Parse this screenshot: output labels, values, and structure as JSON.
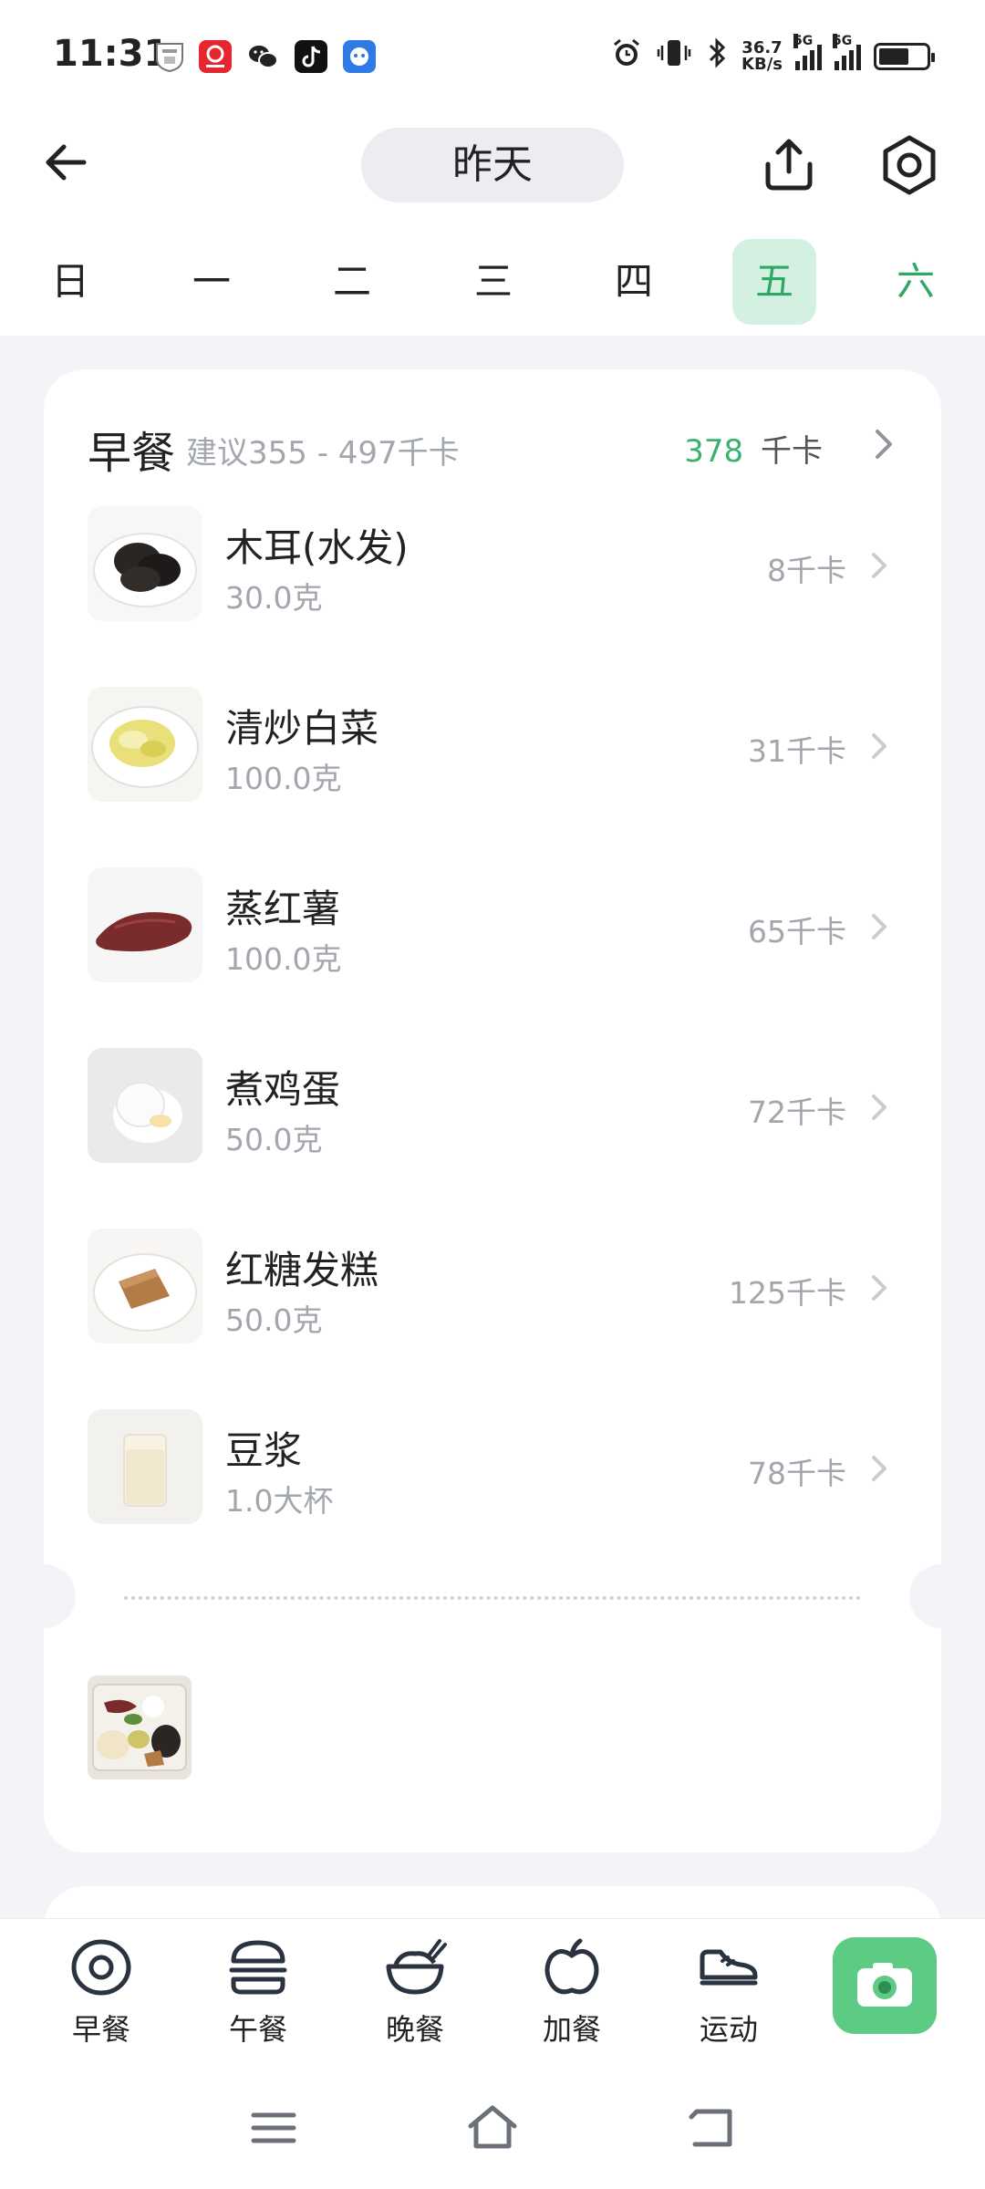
{
  "status_bar": {
    "time": "11:31",
    "net_speed_top": "36.7",
    "net_speed_bottom": "KB/s",
    "sim1": "5G",
    "sim2": "5G",
    "battery_level": 0.58,
    "app_icons": [
      "school-badge-icon",
      "shopping-live-icon",
      "wechat-icon",
      "tiktok-icon",
      "assistant-bot-icon"
    ]
  },
  "header": {
    "date_label": "昨天",
    "icons": [
      "back-arrow-icon",
      "share-upload-icon",
      "settings-ring-icon"
    ]
  },
  "weekdays": [
    {
      "label": "日",
      "state": "normal"
    },
    {
      "label": "一",
      "state": "normal"
    },
    {
      "label": "二",
      "state": "normal"
    },
    {
      "label": "三",
      "state": "normal"
    },
    {
      "label": "四",
      "state": "normal"
    },
    {
      "label": "五",
      "state": "selected"
    },
    {
      "label": "六",
      "state": "future"
    }
  ],
  "meal": {
    "title": "早餐",
    "suggestion": "建议355 - 497千卡",
    "total_kcal": "378",
    "unit": "千卡",
    "foods": [
      {
        "name": "木耳(水发)",
        "amount": "30.0克",
        "kcal": "8千卡",
        "image": "black-fungus"
      },
      {
        "name": "清炒白菜",
        "amount": "100.0克",
        "kcal": "31千卡",
        "image": "stir-fried-cabbage"
      },
      {
        "name": "蒸红薯",
        "amount": "100.0克",
        "kcal": "65千卡",
        "image": "sweet-potato"
      },
      {
        "name": "煮鸡蛋",
        "amount": "50.0克",
        "kcal": "72千卡",
        "image": "boiled-egg"
      },
      {
        "name": "红糖发糕",
        "amount": "50.0克",
        "kcal": "125千卡",
        "image": "brown-sugar-cake"
      },
      {
        "name": "豆浆",
        "amount": "1.0大杯",
        "kcal": "78千卡",
        "image": "soy-milk"
      }
    ]
  },
  "bottom_nav": {
    "items": [
      {
        "label": "早餐",
        "icon": "egg-plate-icon"
      },
      {
        "label": "午餐",
        "icon": "burger-icon"
      },
      {
        "label": "晚餐",
        "icon": "rice-bowl-icon"
      },
      {
        "label": "加餐",
        "icon": "apple-icon"
      },
      {
        "label": "运动",
        "icon": "sneaker-icon"
      }
    ],
    "camera_icon": "camera-icon"
  },
  "colors": {
    "accent_green": "#3bb16e",
    "selected_day_bg": "#d3f0e0",
    "camera_button": "#5ecb84",
    "page_bg": "#f3f4f8"
  }
}
